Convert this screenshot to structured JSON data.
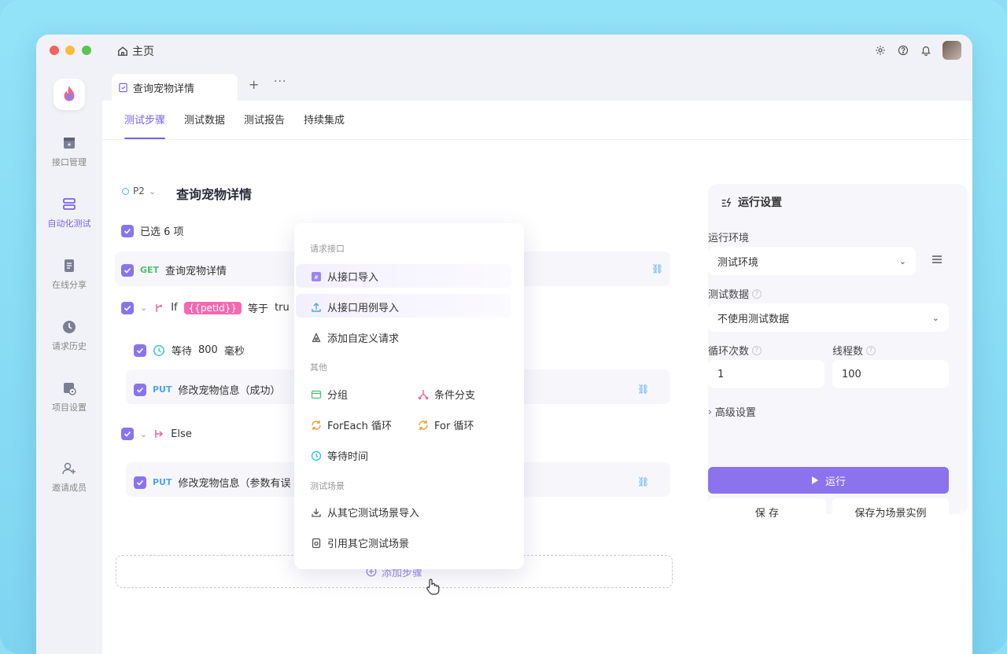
{
  "titlebar": {
    "home_label": "主页"
  },
  "tabs": {
    "doc_tab_label": "查询宠物详情",
    "add": "+",
    "more": "···"
  },
  "sidebar": {
    "items": [
      {
        "label": "接口管理"
      },
      {
        "label": "自动化测试"
      },
      {
        "label": "在线分享"
      },
      {
        "label": "请求历史"
      },
      {
        "label": "项目设置"
      },
      {
        "label": "邀请成员"
      }
    ]
  },
  "subtabs": [
    "测试步骤",
    "测试数据",
    "测试报告",
    "持续集成"
  ],
  "case": {
    "priority": "P2",
    "title": "查询宠物详情",
    "selected": "已选 6 项"
  },
  "steps": {
    "get_method": "GET",
    "get_name": "查询宠物详情",
    "if_label": "If",
    "if_var": "{{petId}}",
    "if_op": "等于",
    "if_val": "tru",
    "wait_label": "等待",
    "wait_value": "800",
    "wait_unit": "毫秒",
    "put_method": "PUT",
    "put1_name": "修改宠物信息（成功）",
    "else_label": "Else",
    "put2_name": "修改宠物信息（参数有误"
  },
  "add_step": "添加步骤",
  "dropdown": {
    "section1": "请求接口",
    "import_api": "从接口导入",
    "import_case": "从接口用例导入",
    "custom_request": "添加自定义请求",
    "section2": "其他",
    "group": "分组",
    "branch": "条件分支",
    "foreach": "ForEach 循环",
    "for": "For 循环",
    "wait_time": "等待时间",
    "section3": "测试场景",
    "import_scene": "从其它测试场景导入",
    "ref_scene": "引用其它测试场景"
  },
  "run_settings": {
    "title": "运行设置",
    "env_label": "运行环境",
    "env_value": "测试环境",
    "data_label": "测试数据",
    "data_value": "不使用测试数据",
    "loop_label": "循环次数",
    "loop_value": "1",
    "thread_label": "线程数",
    "thread_value": "100",
    "advanced": "高级设置",
    "run": "运行",
    "save": "保 存",
    "save_as": "保存为场景实例"
  },
  "colors": {
    "accent": "#7b61e8",
    "get": "#4cbf6e",
    "put": "#4aa7ee",
    "var": "#f667b0"
  }
}
